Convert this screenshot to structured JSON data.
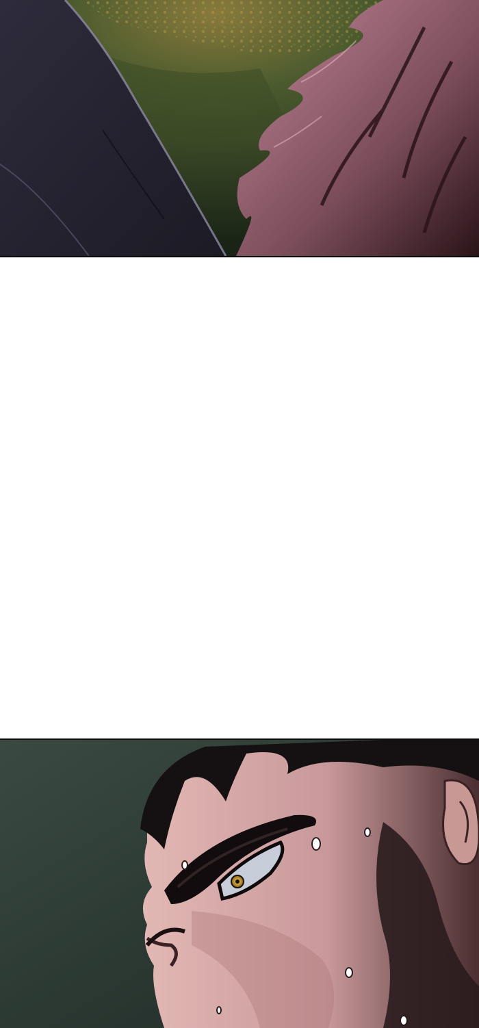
{
  "comic": {
    "panels": [
      {
        "id": "panel-1",
        "scene": "hooded-figure-and-spiky-haired-character-in-forest",
        "palette": {
          "foliage": "#4a5a2e",
          "foliage_dark": "#1f2a18",
          "cloak": "#2a2836",
          "cloak_edge": "#8e8aa4",
          "hair": "#b27c8c",
          "hair_shadow": "#3a1e26"
        }
      },
      {
        "id": "gutter",
        "scene": "blank-white-space",
        "palette": {
          "background": "#ffffff"
        }
      },
      {
        "id": "panel-2",
        "scene": "close-up-sweating-man-glaring",
        "palette": {
          "background": "#2c3a34",
          "skin": "#d6aaa8",
          "skin_shadow": "#5a3a3c",
          "hair": "#151012",
          "eye": "#c8a030",
          "sclera": "#c6ccd8"
        }
      }
    ]
  }
}
